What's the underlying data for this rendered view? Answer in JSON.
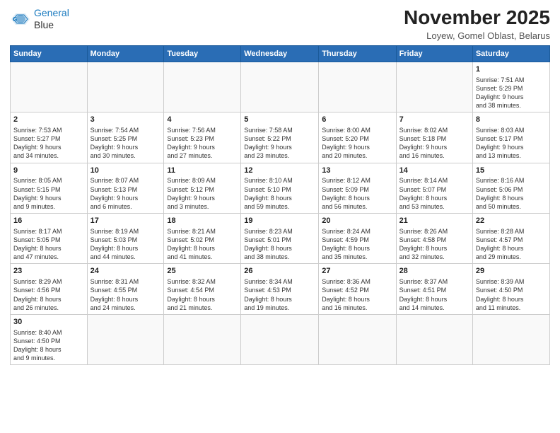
{
  "header": {
    "logo_line1": "General",
    "logo_line2": "Blue",
    "month_title": "November 2025",
    "subtitle": "Loyew, Gomel Oblast, Belarus"
  },
  "weekdays": [
    "Sunday",
    "Monday",
    "Tuesday",
    "Wednesday",
    "Thursday",
    "Friday",
    "Saturday"
  ],
  "weeks": [
    [
      {
        "day": "",
        "info": ""
      },
      {
        "day": "",
        "info": ""
      },
      {
        "day": "",
        "info": ""
      },
      {
        "day": "",
        "info": ""
      },
      {
        "day": "",
        "info": ""
      },
      {
        "day": "",
        "info": ""
      },
      {
        "day": "1",
        "info": "Sunrise: 7:51 AM\nSunset: 5:29 PM\nDaylight: 9 hours\nand 38 minutes."
      }
    ],
    [
      {
        "day": "2",
        "info": "Sunrise: 7:53 AM\nSunset: 5:27 PM\nDaylight: 9 hours\nand 34 minutes."
      },
      {
        "day": "3",
        "info": "Sunrise: 7:54 AM\nSunset: 5:25 PM\nDaylight: 9 hours\nand 30 minutes."
      },
      {
        "day": "4",
        "info": "Sunrise: 7:56 AM\nSunset: 5:23 PM\nDaylight: 9 hours\nand 27 minutes."
      },
      {
        "day": "5",
        "info": "Sunrise: 7:58 AM\nSunset: 5:22 PM\nDaylight: 9 hours\nand 23 minutes."
      },
      {
        "day": "6",
        "info": "Sunrise: 8:00 AM\nSunset: 5:20 PM\nDaylight: 9 hours\nand 20 minutes."
      },
      {
        "day": "7",
        "info": "Sunrise: 8:02 AM\nSunset: 5:18 PM\nDaylight: 9 hours\nand 16 minutes."
      },
      {
        "day": "8",
        "info": "Sunrise: 8:03 AM\nSunset: 5:17 PM\nDaylight: 9 hours\nand 13 minutes."
      }
    ],
    [
      {
        "day": "9",
        "info": "Sunrise: 8:05 AM\nSunset: 5:15 PM\nDaylight: 9 hours\nand 9 minutes."
      },
      {
        "day": "10",
        "info": "Sunrise: 8:07 AM\nSunset: 5:13 PM\nDaylight: 9 hours\nand 6 minutes."
      },
      {
        "day": "11",
        "info": "Sunrise: 8:09 AM\nSunset: 5:12 PM\nDaylight: 9 hours\nand 3 minutes."
      },
      {
        "day": "12",
        "info": "Sunrise: 8:10 AM\nSunset: 5:10 PM\nDaylight: 8 hours\nand 59 minutes."
      },
      {
        "day": "13",
        "info": "Sunrise: 8:12 AM\nSunset: 5:09 PM\nDaylight: 8 hours\nand 56 minutes."
      },
      {
        "day": "14",
        "info": "Sunrise: 8:14 AM\nSunset: 5:07 PM\nDaylight: 8 hours\nand 53 minutes."
      },
      {
        "day": "15",
        "info": "Sunrise: 8:16 AM\nSunset: 5:06 PM\nDaylight: 8 hours\nand 50 minutes."
      }
    ],
    [
      {
        "day": "16",
        "info": "Sunrise: 8:17 AM\nSunset: 5:05 PM\nDaylight: 8 hours\nand 47 minutes."
      },
      {
        "day": "17",
        "info": "Sunrise: 8:19 AM\nSunset: 5:03 PM\nDaylight: 8 hours\nand 44 minutes."
      },
      {
        "day": "18",
        "info": "Sunrise: 8:21 AM\nSunset: 5:02 PM\nDaylight: 8 hours\nand 41 minutes."
      },
      {
        "day": "19",
        "info": "Sunrise: 8:23 AM\nSunset: 5:01 PM\nDaylight: 8 hours\nand 38 minutes."
      },
      {
        "day": "20",
        "info": "Sunrise: 8:24 AM\nSunset: 4:59 PM\nDaylight: 8 hours\nand 35 minutes."
      },
      {
        "day": "21",
        "info": "Sunrise: 8:26 AM\nSunset: 4:58 PM\nDaylight: 8 hours\nand 32 minutes."
      },
      {
        "day": "22",
        "info": "Sunrise: 8:28 AM\nSunset: 4:57 PM\nDaylight: 8 hours\nand 29 minutes."
      }
    ],
    [
      {
        "day": "23",
        "info": "Sunrise: 8:29 AM\nSunset: 4:56 PM\nDaylight: 8 hours\nand 26 minutes."
      },
      {
        "day": "24",
        "info": "Sunrise: 8:31 AM\nSunset: 4:55 PM\nDaylight: 8 hours\nand 24 minutes."
      },
      {
        "day": "25",
        "info": "Sunrise: 8:32 AM\nSunset: 4:54 PM\nDaylight: 8 hours\nand 21 minutes."
      },
      {
        "day": "26",
        "info": "Sunrise: 8:34 AM\nSunset: 4:53 PM\nDaylight: 8 hours\nand 19 minutes."
      },
      {
        "day": "27",
        "info": "Sunrise: 8:36 AM\nSunset: 4:52 PM\nDaylight: 8 hours\nand 16 minutes."
      },
      {
        "day": "28",
        "info": "Sunrise: 8:37 AM\nSunset: 4:51 PM\nDaylight: 8 hours\nand 14 minutes."
      },
      {
        "day": "29",
        "info": "Sunrise: 8:39 AM\nSunset: 4:50 PM\nDaylight: 8 hours\nand 11 minutes."
      }
    ],
    [
      {
        "day": "30",
        "info": "Sunrise: 8:40 AM\nSunset: 4:50 PM\nDaylight: 8 hours\nand 9 minutes."
      },
      {
        "day": "",
        "info": ""
      },
      {
        "day": "",
        "info": ""
      },
      {
        "day": "",
        "info": ""
      },
      {
        "day": "",
        "info": ""
      },
      {
        "day": "",
        "info": ""
      },
      {
        "day": "",
        "info": ""
      }
    ]
  ]
}
